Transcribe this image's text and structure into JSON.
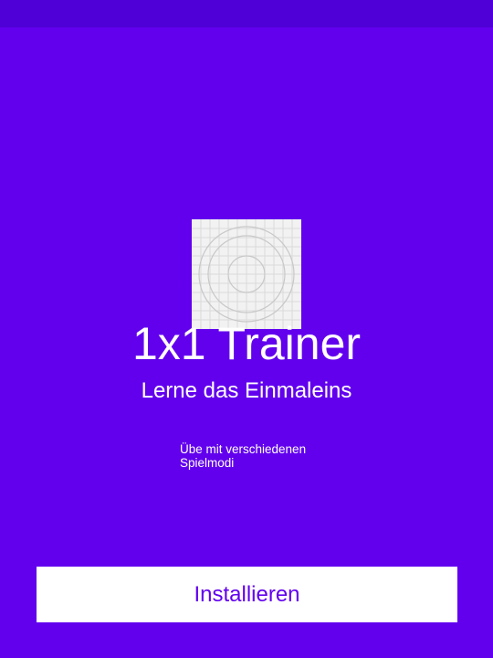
{
  "app": {
    "title": "1x1 Trainer",
    "subtitle": "Lerne das Einmaleins",
    "feature": "Übe mit verschiedenen Spielmodi",
    "icon": "placeholder-app-icon"
  },
  "actions": {
    "install_label": "Installieren"
  },
  "colors": {
    "background": "#6200EE",
    "status_bar": "#4F00D6",
    "button_background": "#FFFFFF",
    "button_text": "#6200EE"
  }
}
